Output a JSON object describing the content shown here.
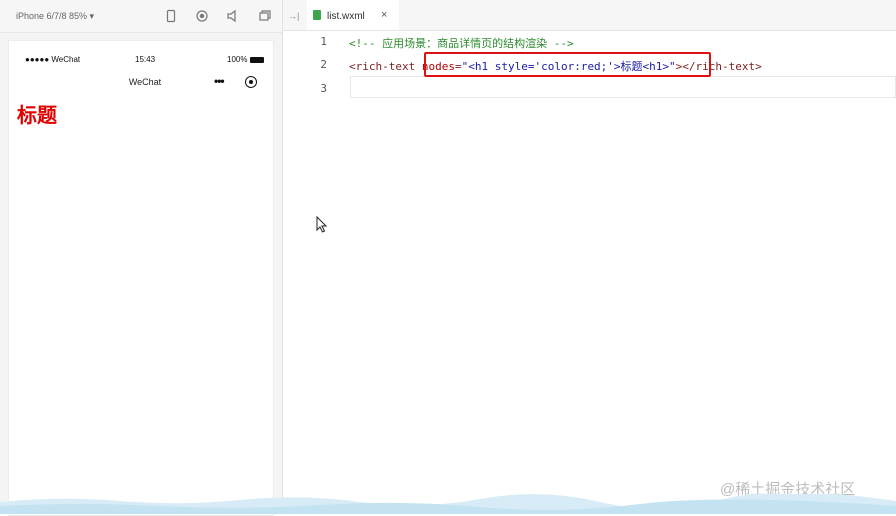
{
  "simulator": {
    "device": "iPhone 6/7/8 85% ▾",
    "status": {
      "carrier": "●●●●● WeChat",
      "time": "15:43",
      "battery": "100%"
    },
    "nav_title": "WeChat",
    "capsule_dots": "•••",
    "heading": "标题"
  },
  "editor": {
    "tab_name": "list.wxml",
    "tab_close": "×",
    "collapse": "→|",
    "lines": [
      {
        "num": "1",
        "comment": "<!-- 应用场景：商品详情页的结构渲染 -->"
      },
      {
        "num": "2",
        "open_tag": "<rich-text ",
        "attr": "nodes",
        "eq": "=",
        "value": "\"<h1 style='color:red;'>标题<h1>\"",
        "close": "></rich-text>"
      },
      {
        "num": "3"
      }
    ]
  },
  "watermark": "@稀土掘金技术社区"
}
